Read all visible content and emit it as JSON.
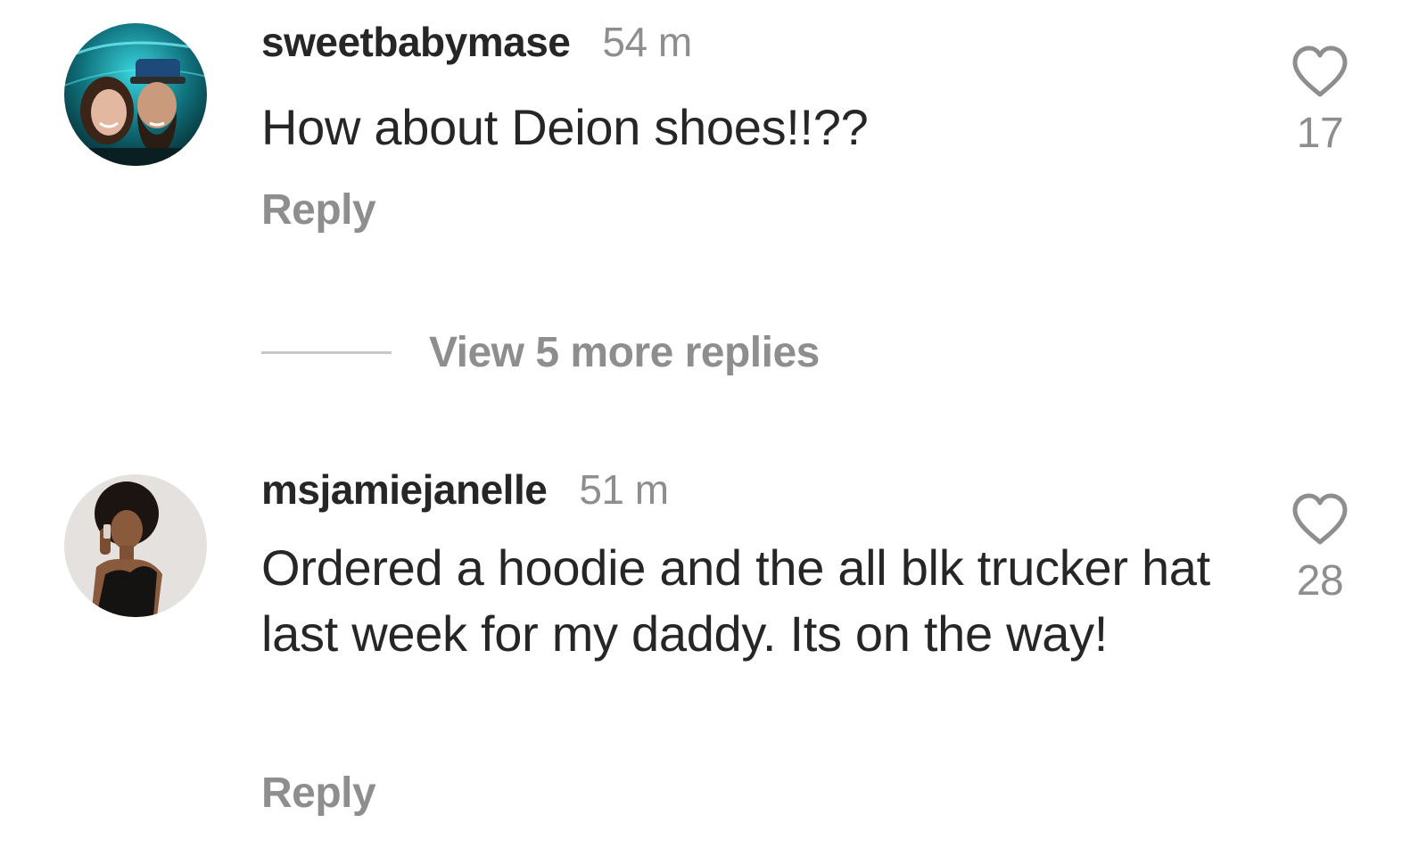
{
  "comments": [
    {
      "username": "sweetbabymase",
      "time": "54 m",
      "text": "How about Deion shoes!!??",
      "reply_label": "Reply",
      "like_count": "17",
      "avatar_icon": "couple-photo-avatar"
    },
    {
      "username": "msjamiejanelle",
      "time": "51 m",
      "text": "Ordered a hoodie and the all blk trucker hat last week for my daddy. Its on the way!",
      "reply_label": "Reply",
      "like_count": "28",
      "avatar_icon": "woman-photo-avatar"
    }
  ],
  "view_replies": {
    "label": "View 5 more replies"
  },
  "icons": {
    "like": "heart-outline-icon"
  },
  "colors": {
    "primary_text": "#262626",
    "secondary_text": "#8e8e8e",
    "divider": "#c7c7c7"
  }
}
